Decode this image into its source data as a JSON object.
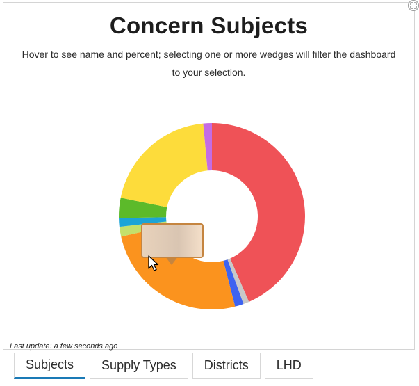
{
  "header": {
    "title": "Concern Subjects",
    "subtitle": "Hover to see name and percent; selecting one or more wedges will filter the dashboard to your selection."
  },
  "footer": {
    "last_update": "Last update: a few seconds ago"
  },
  "tabs": [
    {
      "label": "Subjects",
      "active": true
    },
    {
      "label": "Supply Types",
      "active": false
    },
    {
      "label": "Districts",
      "active": false
    },
    {
      "label": "LHD",
      "active": false
    }
  ],
  "chart_data": {
    "type": "pie",
    "donut": true,
    "slices": [
      {
        "value": 43.5,
        "color": "#ef5257"
      },
      {
        "value": 1.0,
        "color": "#c8c8c8"
      },
      {
        "value": 1.5,
        "color": "#3d63f0"
      },
      {
        "value": 25.5,
        "color": "#fb931e"
      },
      {
        "value": 1.7,
        "color": "#c4e06a"
      },
      {
        "value": 1.5,
        "color": "#1ca4d6"
      },
      {
        "value": 3.5,
        "color": "#5cba2a"
      },
      {
        "value": 20.3,
        "color": "#fddc3b"
      },
      {
        "value": 1.5,
        "color": "#c46ce4"
      }
    ]
  },
  "icons": {
    "expand": "expand-icon",
    "cursor": "pointer-cursor-icon"
  }
}
